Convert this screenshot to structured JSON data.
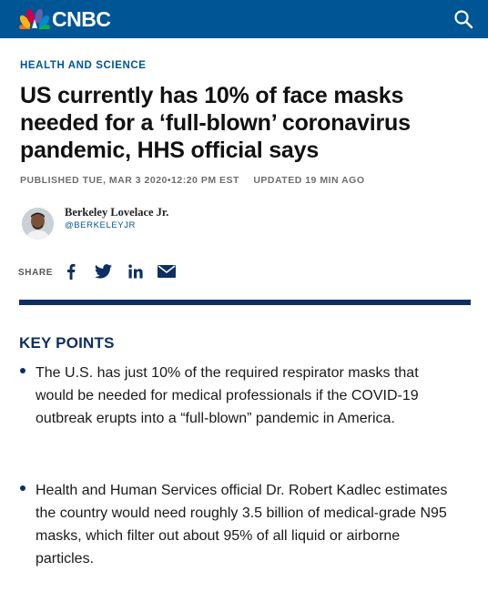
{
  "header": {
    "logo_text": "CNBC",
    "brand_color": "#005594",
    "search_icon": "search-icon"
  },
  "article": {
    "section": "HEALTH AND SCIENCE",
    "headline": "US currently has 10% of face masks needed for a ‘full-blown’ coronavirus pandemic, HHS official says",
    "published": "PUBLISHED TUE, MAR 3 2020•12:20 PM EST",
    "updated": "UPDATED 19 MIN AGO",
    "author": {
      "name": "Berkeley Lovelace Jr.",
      "handle": "@BERKELEYJR"
    },
    "share": {
      "label": "SHARE",
      "icons": [
        "facebook-icon",
        "twitter-icon",
        "linkedin-icon",
        "email-icon"
      ]
    },
    "key_points": {
      "title": "KEY POINTS",
      "items": [
        "The U.S. has just 10% of the required respirator masks that would be needed for medical professionals if the COVID-19 outbreak erupts into a “full-blown” pandemic in America.",
        "Health and Human Services official Dr. Robert Kadlec estimates the country would need roughly 3.5 billion of medical-grade N95 masks, which filter out about 95% of all liquid or airborne particles."
      ]
    }
  },
  "colors": {
    "accent": "#005594",
    "navy": "#0e2f63"
  }
}
